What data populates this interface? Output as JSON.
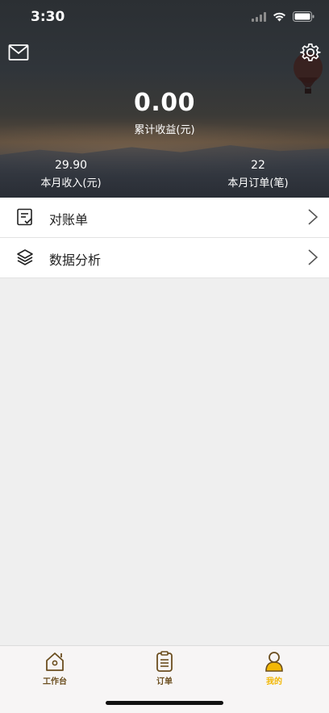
{
  "status_bar": {
    "time": "3:30"
  },
  "hero": {
    "total_value": "0.00",
    "total_label": "累计收益(元)",
    "stats": [
      {
        "value": "29.90",
        "label": "本月收入(元)"
      },
      {
        "value": "22",
        "label": "本月订单(笔)"
      }
    ],
    "left_icon": "mail-icon",
    "right_icon": "gear-icon"
  },
  "menu": {
    "items": [
      {
        "label": "对账单",
        "icon": "statement-icon"
      },
      {
        "label": "数据分析",
        "icon": "layers-icon"
      }
    ]
  },
  "tabbar": {
    "items": [
      {
        "label": "工作台",
        "icon": "home-icon",
        "active": false
      },
      {
        "label": "订单",
        "icon": "clipboard-icon",
        "active": false
      },
      {
        "label": "我的",
        "icon": "user-icon",
        "active": true
      }
    ],
    "active_color": "#f2b705",
    "inactive_color": "#6b4e1f"
  }
}
